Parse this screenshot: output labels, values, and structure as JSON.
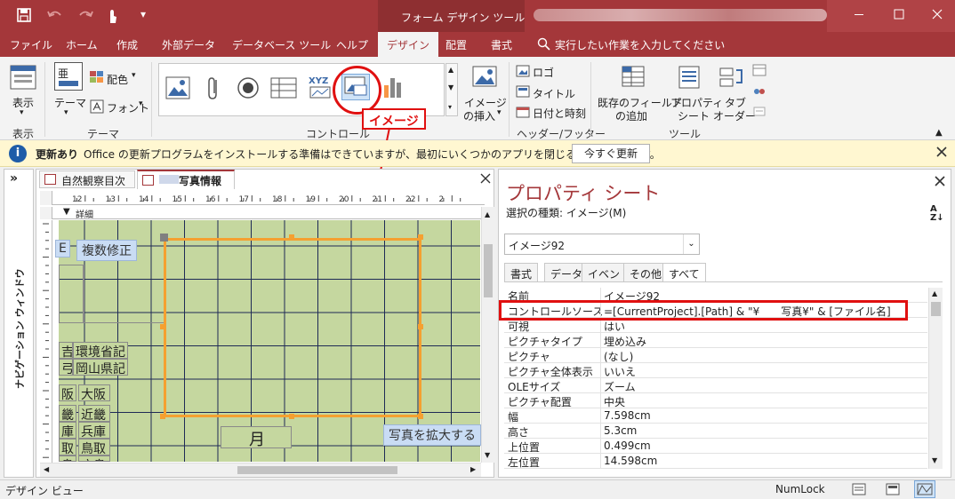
{
  "titlebar": {
    "context_tab": "フォーム デザイン ツール",
    "qat_more": "▾"
  },
  "tabs": [
    "ファイル",
    "ホーム",
    "作成",
    "外部データ",
    "データベース ツール",
    "ヘルプ",
    "デザイン",
    "配置",
    "書式"
  ],
  "tell_me": "実行したい作業を入力してください",
  "ribbon": {
    "view_label": "表示",
    "view_group": "表示",
    "theme_label": "テーマ",
    "color_label": "配色",
    "font_label": "フォント",
    "theme_group": "テーマ",
    "controls_group": "コントロール",
    "image_insert_line1": "イメージ",
    "image_insert_line2": "の挿入",
    "logo": "ロゴ",
    "title": "タイトル",
    "datetime": "日付と時刻",
    "header_footer_group": "ヘッダー/フッター",
    "existing_fields_line1": "既存のフィールド",
    "existing_fields_line2": "の追加",
    "property_sheet_line1": "プロパティ",
    "property_sheet_line2": "シート",
    "tab_order_line1": "タブ",
    "tab_order_line2": "オーダー",
    "tools_group": "ツール"
  },
  "annotation": {
    "label": "イメージ",
    "color": "#e01010"
  },
  "infobar": {
    "title": "更新あり",
    "message": "Office の更新プログラムをインストールする準備はできていますが、最初にいくつかのアプリを閉じる必要があります。",
    "button": "今すぐ更新"
  },
  "nav_pane": {
    "label": "ナビゲーション ウィンドウ",
    "toggle": "»"
  },
  "doc_tabs": [
    {
      "label": "自然観察目次"
    },
    {
      "label": "写真情報"
    }
  ],
  "ruler_numbers": [
    "12",
    "13",
    "14",
    "15",
    "16",
    "17",
    "18",
    "19",
    "20",
    "21",
    "22",
    "2"
  ],
  "section_label": "詳細",
  "form_controls": {
    "multi_edit_button": "複数修正",
    "partial_e": "E",
    "env_label": "環境省記",
    "env_prefix": "吉",
    "okayama_label": "岡山県記",
    "okayama_prefix": "弓",
    "osaka1": "阪",
    "osaka2": "大阪",
    "kinki1": "畿",
    "kinki2": "近畿",
    "hyogo1": "庫",
    "hyogo2": "兵庫",
    "tottori1": "取",
    "tottori2": "鳥取",
    "shimane1": "島",
    "shimane2": "広島",
    "month": "月",
    "enlarge_button": "写真を拡大する"
  },
  "property_sheet": {
    "title": "プロパティ シート",
    "selection_type_label": "選択の種類: イメージ(M)",
    "selected_object": "イメージ92",
    "tabs": [
      "書式",
      "データ",
      "イベント",
      "その他",
      "すべて"
    ],
    "active_tab": "すべて",
    "rows": [
      {
        "key": "名前",
        "value": "イメージ92"
      },
      {
        "key": "コントロールソース",
        "value": "=[CurrentProject].[Path] & \"¥　　写真¥\" & [ファイル名]"
      },
      {
        "key": "可視",
        "value": "はい"
      },
      {
        "key": "ピクチャタイプ",
        "value": "埋め込み"
      },
      {
        "key": "ピクチャ",
        "value": "(なし)"
      },
      {
        "key": "ピクチャ全体表示",
        "value": "いいえ"
      },
      {
        "key": "OLEサイズ",
        "value": "ズーム"
      },
      {
        "key": "ピクチャ配置",
        "value": "中央"
      },
      {
        "key": "幅",
        "value": "7.598cm"
      },
      {
        "key": "高さ",
        "value": "5.3cm"
      },
      {
        "key": "上位置",
        "value": "0.499cm"
      },
      {
        "key": "左位置",
        "value": "14.598cm"
      }
    ]
  },
  "statusbar": {
    "left": "デザイン ビュー",
    "numlock": "NumLock"
  },
  "colors": {
    "accent": "#a4373a",
    "grid_bg": "#c5d79f",
    "selection": "#f5a030"
  }
}
